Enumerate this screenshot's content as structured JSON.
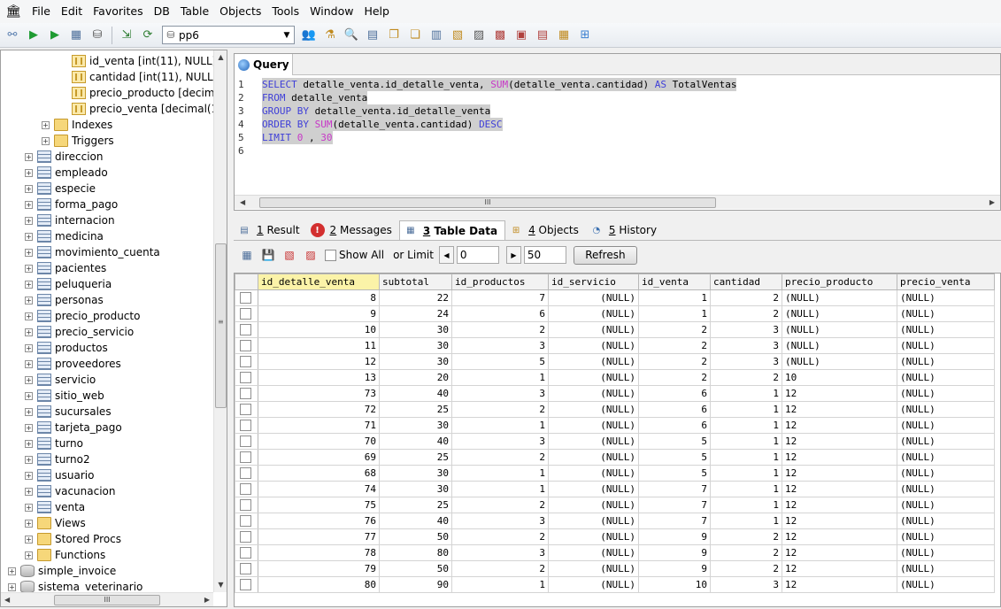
{
  "menu": [
    "File",
    "Edit",
    "Favorites",
    "DB",
    "Table",
    "Objects",
    "Tools",
    "Window",
    "Help"
  ],
  "toolbar": {
    "database": "pp6"
  },
  "tree": {
    "columns": [
      "id_venta [int(11), NULL]",
      "cantidad [int(11), NULL]",
      "precio_producto [decimal",
      "precio_venta [decimal(10,("
    ],
    "venta_children": [
      "Indexes",
      "Triggers"
    ],
    "tables": [
      "direccion",
      "empleado",
      "especie",
      "forma_pago",
      "internacion",
      "medicina",
      "movimiento_cuenta",
      "pacientes",
      "peluqueria",
      "personas",
      "precio_producto",
      "precio_servicio",
      "productos",
      "proveedores",
      "servicio",
      "sitio_web",
      "sucursales",
      "tarjeta_pago",
      "turno",
      "turno2",
      "usuario",
      "vacunacion",
      "venta"
    ],
    "folders": [
      "Views",
      "Stored Procs",
      "Functions"
    ],
    "databases": [
      "simple_invoice",
      "sistema_veterinario"
    ]
  },
  "query": {
    "tab_label": "Query",
    "line_numbers": [
      "1",
      "2",
      "3",
      "4",
      "5",
      "6"
    ],
    "lines": [
      [
        {
          "t": "SELECT",
          "c": "kw"
        },
        {
          "t": " detalle_venta.id_detalle_venta, ",
          "c": ""
        },
        {
          "t": "SUM",
          "c": "fn"
        },
        {
          "t": "(detalle_venta.cantidad) ",
          "c": ""
        },
        {
          "t": "AS",
          "c": "kw"
        },
        {
          "t": " TotalVentas",
          "c": ""
        }
      ],
      [
        {
          "t": "FROM",
          "c": "kw"
        },
        {
          "t": " detalle_venta",
          "c": ""
        }
      ],
      [
        {
          "t": "GROUP BY",
          "c": "kw"
        },
        {
          "t": " detalle_venta.id_detalle_venta",
          "c": ""
        }
      ],
      [
        {
          "t": "ORDER BY",
          "c": "kw"
        },
        {
          "t": " ",
          "c": ""
        },
        {
          "t": "SUM",
          "c": "fn"
        },
        {
          "t": "(detalle_venta.cantidad) ",
          "c": ""
        },
        {
          "t": "DESC",
          "c": "kw"
        }
      ],
      [
        {
          "t": "LIMIT",
          "c": "kw"
        },
        {
          "t": " ",
          "c": ""
        },
        {
          "t": "0",
          "c": "num"
        },
        {
          "t": " , ",
          "c": ""
        },
        {
          "t": "30",
          "c": "num"
        }
      ],
      []
    ]
  },
  "result_tabs": [
    {
      "num": "1",
      "label": "Result"
    },
    {
      "num": "2",
      "label": "Messages"
    },
    {
      "num": "3",
      "label": "Table Data"
    },
    {
      "num": "4",
      "label": "Objects"
    },
    {
      "num": "5",
      "label": "History"
    }
  ],
  "result_toolbar": {
    "show_all": "Show All",
    "or_limit": "or Limit",
    "offset": "0",
    "limit": "50",
    "refresh": "Refresh"
  },
  "grid": {
    "columns": [
      "id_detalle_venta",
      "subtotal",
      "id_productos",
      "id_servicio",
      "id_venta",
      "cantidad",
      "precio_producto",
      "precio_venta"
    ],
    "rows": [
      [
        "8",
        "22",
        "7",
        "(NULL)",
        "1",
        "2",
        "(NULL)",
        "(NULL)"
      ],
      [
        "9",
        "24",
        "6",
        "(NULL)",
        "1",
        "2",
        "(NULL)",
        "(NULL)"
      ],
      [
        "10",
        "30",
        "2",
        "(NULL)",
        "2",
        "3",
        "(NULL)",
        "(NULL)"
      ],
      [
        "11",
        "30",
        "3",
        "(NULL)",
        "2",
        "3",
        "(NULL)",
        "(NULL)"
      ],
      [
        "12",
        "30",
        "5",
        "(NULL)",
        "2",
        "3",
        "(NULL)",
        "(NULL)"
      ],
      [
        "13",
        "20",
        "1",
        "(NULL)",
        "2",
        "2",
        "10",
        "(NULL)"
      ],
      [
        "73",
        "40",
        "3",
        "(NULL)",
        "6",
        "1",
        "12",
        "(NULL)"
      ],
      [
        "72",
        "25",
        "2",
        "(NULL)",
        "6",
        "1",
        "12",
        "(NULL)"
      ],
      [
        "71",
        "30",
        "1",
        "(NULL)",
        "6",
        "1",
        "12",
        "(NULL)"
      ],
      [
        "70",
        "40",
        "3",
        "(NULL)",
        "5",
        "1",
        "12",
        "(NULL)"
      ],
      [
        "69",
        "25",
        "2",
        "(NULL)",
        "5",
        "1",
        "12",
        "(NULL)"
      ],
      [
        "68",
        "30",
        "1",
        "(NULL)",
        "5",
        "1",
        "12",
        "(NULL)"
      ],
      [
        "74",
        "30",
        "1",
        "(NULL)",
        "7",
        "1",
        "12",
        "(NULL)"
      ],
      [
        "75",
        "25",
        "2",
        "(NULL)",
        "7",
        "1",
        "12",
        "(NULL)"
      ],
      [
        "76",
        "40",
        "3",
        "(NULL)",
        "7",
        "1",
        "12",
        "(NULL)"
      ],
      [
        "77",
        "50",
        "2",
        "(NULL)",
        "9",
        "2",
        "12",
        "(NULL)"
      ],
      [
        "78",
        "80",
        "3",
        "(NULL)",
        "9",
        "2",
        "12",
        "(NULL)"
      ],
      [
        "79",
        "50",
        "2",
        "(NULL)",
        "9",
        "2",
        "12",
        "(NULL)"
      ],
      [
        "80",
        "90",
        "1",
        "(NULL)",
        "10",
        "3",
        "12",
        "(NULL)"
      ]
    ]
  }
}
